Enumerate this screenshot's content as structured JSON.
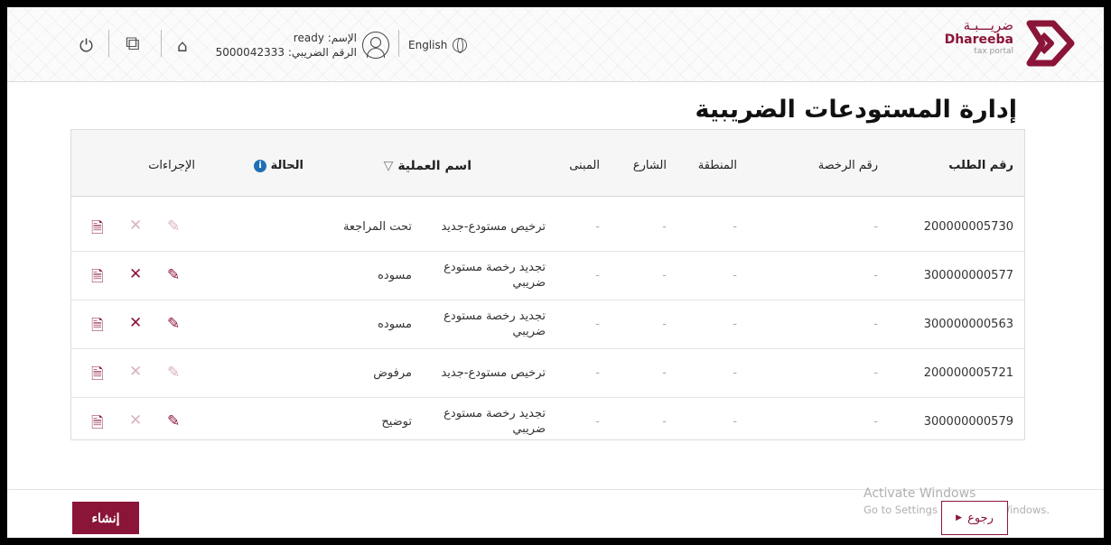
{
  "header": {
    "logo_ar": "ضريـــبـة",
    "logo_en": "Dhareeba",
    "logo_sub": "tax portal",
    "language": "English",
    "user_name_line": "الإسم: ready",
    "tax_number_line": "الرقم الضريبي: 5000042333"
  },
  "page": {
    "title": "إدارة المستودعات الضريبية"
  },
  "table": {
    "columns": {
      "request_no": "رقم الطلب",
      "license_no": "رقم الرخصة",
      "area": "المنطقة",
      "street": "الشارع",
      "building": "المبنى",
      "operation": "اسم العملية",
      "status": "الحالة",
      "actions": "الإجراءات"
    },
    "rows": [
      {
        "request_no": "200000005730",
        "license_no": "-",
        "area": "-",
        "street": "-",
        "building": "-",
        "operation": "ترخيص مستودع-جديد",
        "status": "تحت المراجعة"
      },
      {
        "request_no": "300000000577",
        "license_no": "-",
        "area": "-",
        "street": "-",
        "building": "-",
        "operation": "تجديد رخصة مستودع ضريبي",
        "status": "مسوده"
      },
      {
        "request_no": "300000000563",
        "license_no": "-",
        "area": "-",
        "street": "-",
        "building": "-",
        "operation": "تجديد رخصة مستودع ضريبي",
        "status": "مسوده"
      },
      {
        "request_no": "200000005721",
        "license_no": "-",
        "area": "-",
        "street": "-",
        "building": "-",
        "operation": "ترخيص مستودع-جديد",
        "status": "مرفوض"
      },
      {
        "request_no": "300000000579",
        "license_no": "-",
        "area": "-",
        "street": "-",
        "building": "-",
        "operation": "تجديد رخصة مستودع ضريبي",
        "status": "توضيح"
      }
    ]
  },
  "footer": {
    "create_label": "إنشاء",
    "back_label": "رجوع"
  },
  "watermark": {
    "line1": "Activate Windows",
    "line2": "Go to Settings to activate Windows."
  },
  "colors": {
    "brand": "#8a1538",
    "info": "#1f6fb5"
  }
}
